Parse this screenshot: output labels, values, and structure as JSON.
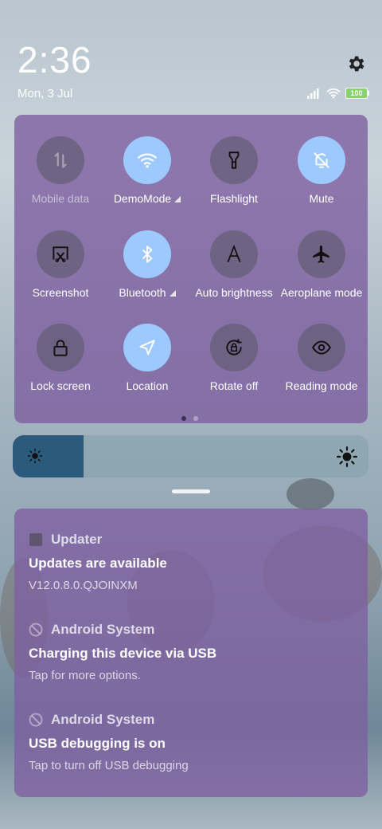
{
  "status": {
    "time": "2:36",
    "date": "Mon, 3 Jul",
    "battery": "100",
    "icons": [
      "signal-icon",
      "wifi-icon",
      "battery-icon"
    ]
  },
  "quick_settings": {
    "tiles": [
      {
        "label": "Mobile data",
        "icon": "mobile-data-icon",
        "active": false,
        "disabled": true
      },
      {
        "label": "DemoMode",
        "icon": "wifi-icon",
        "active": true,
        "expandable": true
      },
      {
        "label": "Flashlight",
        "icon": "flashlight-icon",
        "active": false
      },
      {
        "label": "Mute",
        "icon": "bell-off-icon",
        "active": true
      },
      {
        "label": "Screenshot",
        "icon": "screenshot-icon",
        "active": false
      },
      {
        "label": "Bluetooth",
        "icon": "bluetooth-icon",
        "active": true,
        "expandable": true
      },
      {
        "label": "Auto brightness",
        "icon": "auto-brightness-icon",
        "active": false
      },
      {
        "label": "Aeroplane mode",
        "icon": "airplane-icon",
        "active": false
      },
      {
        "label": "Lock screen",
        "icon": "lock-icon",
        "active": false
      },
      {
        "label": "Location",
        "icon": "location-icon",
        "active": true
      },
      {
        "label": "Rotate off",
        "icon": "rotate-lock-icon",
        "active": false
      },
      {
        "label": "Reading mode",
        "icon": "eye-icon",
        "active": false
      }
    ],
    "page": {
      "current": 1,
      "total": 2
    }
  },
  "brightness": {
    "level": 0.2
  },
  "notifications": [
    {
      "app": "Updater",
      "title": "Updates are available",
      "body": "V12.0.8.0.QJOINXM"
    },
    {
      "app": "Android System",
      "title": "Charging this device via USB",
      "body": "Tap for more options."
    },
    {
      "app": "Android System",
      "title": "USB debugging is on",
      "body": "Tap to turn off USB debugging"
    }
  ],
  "colors": {
    "panel": "#7d5fa0",
    "tile_active": "#9ec9ff",
    "brightness_fill": "#2c5a7c"
  }
}
